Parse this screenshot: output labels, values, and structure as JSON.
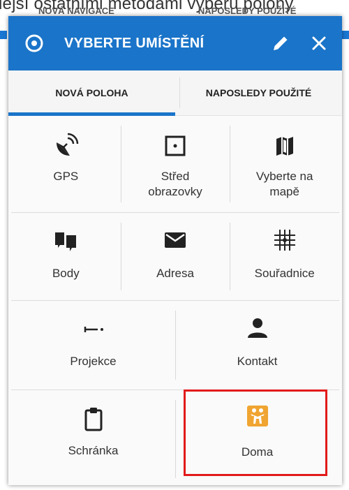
{
  "background": {
    "caption": "iejší ostatními metodami výběru polohy",
    "tab_left": "NOVÁ NAVIGACE",
    "tab_right": "NAPOSLEDY POUŽITÉ"
  },
  "dialog": {
    "title": "VYBERTE UMÍSTĚNÍ",
    "tabs": [
      {
        "label": "NOVÁ POLOHA",
        "active": true
      },
      {
        "label": "NAPOSLEDY POUŽITÉ",
        "active": false
      }
    ],
    "items": [
      {
        "label": "GPS",
        "icon": "satellite-dish-icon"
      },
      {
        "label": "Střed obrazovky",
        "line1": "Střed",
        "line2": "obrazovky",
        "icon": "screen-center-icon"
      },
      {
        "label": "Vyberte na mapě",
        "line1": "Vyberte na",
        "line2": "mapě",
        "icon": "map-icon"
      },
      {
        "label": "Body",
        "icon": "points-icon"
      },
      {
        "label": "Adresa",
        "icon": "envelope-icon"
      },
      {
        "label": "Souřadnice",
        "icon": "coordinates-grid-icon"
      },
      {
        "label": "Projekce",
        "icon": "projection-icon"
      },
      {
        "label": "Kontakt",
        "icon": "contact-person-icon"
      },
      {
        "label": "Schránka",
        "icon": "clipboard-icon"
      },
      {
        "label": "Doma",
        "icon": "home-family-icon"
      }
    ]
  },
  "colors": {
    "title_bar": "#1a74c9",
    "highlight_border": "#e21a1a",
    "home_icon_bg": "#f0a431"
  }
}
